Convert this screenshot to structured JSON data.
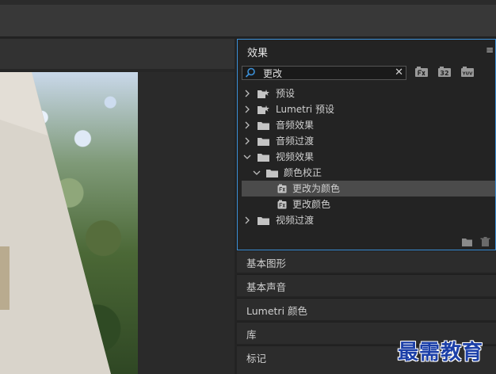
{
  "effects_panel": {
    "tab_label": "效果",
    "menu_glyph": "≡",
    "search": {
      "value": "更改",
      "placeholder": ""
    },
    "clear_glyph": "✕",
    "badges": [
      "fx-accelerated",
      "32-bit",
      "YUV"
    ],
    "badge_texts": [
      "",
      "32",
      "YUV"
    ],
    "tree": [
      {
        "label": "预设",
        "level": 0,
        "expanded": false,
        "kind": "preset-folder"
      },
      {
        "label": "Lumetri 预设",
        "level": 0,
        "expanded": false,
        "kind": "preset-folder"
      },
      {
        "label": "音频效果",
        "level": 0,
        "expanded": false,
        "kind": "folder"
      },
      {
        "label": "音频过渡",
        "level": 0,
        "expanded": false,
        "kind": "folder"
      },
      {
        "label": "视频效果",
        "level": 0,
        "expanded": true,
        "kind": "folder"
      },
      {
        "label": "颜色校正",
        "level": 1,
        "expanded": true,
        "kind": "folder"
      },
      {
        "label": "更改为颜色",
        "level": 2,
        "kind": "effect",
        "selected": true
      },
      {
        "label": "更改颜色",
        "level": 2,
        "kind": "effect"
      },
      {
        "label": "视频过渡",
        "level": 0,
        "expanded": false,
        "kind": "folder"
      }
    ]
  },
  "side_panels": [
    "基本图形",
    "基本声音",
    "Lumetri 颜色",
    "库",
    "标记"
  ],
  "watermark": "最需教育",
  "colors": {
    "accent": "#3b8fd6",
    "selected_row": "#4b4b4b",
    "panel_bg": "#232323"
  }
}
